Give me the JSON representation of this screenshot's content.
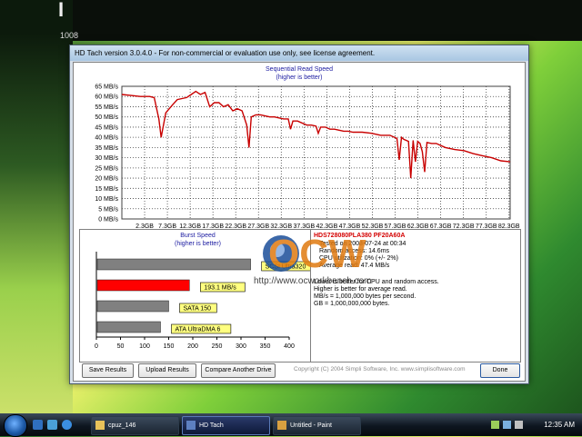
{
  "desktop": {
    "corner_big": "I",
    "corner_number": "1008"
  },
  "window": {
    "title": "HD Tach version 3.0.4.0  - For non-commercial or evaluation use only, see license agreement."
  },
  "sequential": {
    "title": "Sequential Read Speed",
    "subtitle": "(higher is better)"
  },
  "chart_data": [
    {
      "type": "line",
      "title": "Sequential Read Speed",
      "subtitle": "(higher is better)",
      "y_ticks": [
        "65 MB/s",
        "60 MB/s",
        "55 MB/s",
        "50 MB/s",
        "45 MB/s",
        "40 MB/s",
        "35 MB/s",
        "30 MB/s",
        "25 MB/s",
        "20 MB/s",
        "15 MB/s",
        "10 MB/s",
        "5 MB/s",
        "0 MB/s"
      ],
      "x_ticks": [
        "2.3GB",
        "7.3GB",
        "12.3GB",
        "17.3GB",
        "22.3GB",
        "27.3GB",
        "32.3GB",
        "37.3GB",
        "42.3GB",
        "47.3GB",
        "52.3GB",
        "57.3GB",
        "62.3GB",
        "67.3GB",
        "72.3GB",
        "77.3GB",
        "82.3GB"
      ],
      "ylim": [
        0,
        65
      ],
      "xlim": [
        0,
        84
      ],
      "grid": true,
      "series": [
        {
          "color": "#c80000",
          "x": [
            0,
            2,
            4,
            6,
            7,
            8,
            8.5,
            9.5,
            11,
            12,
            13,
            14,
            15,
            16,
            17,
            18,
            19,
            20,
            21,
            22,
            23,
            24,
            25,
            26,
            27,
            27.5,
            28,
            29,
            30,
            32,
            33,
            34,
            35,
            36,
            36.5,
            37,
            38,
            40,
            41,
            42,
            42.5,
            43,
            44,
            45,
            46,
            47,
            48,
            49,
            50,
            52,
            54,
            55,
            56,
            58,
            59.5,
            60,
            60.5,
            61,
            62,
            62.5,
            63,
            63.5,
            64,
            64.5,
            65,
            65.5,
            66,
            67,
            68,
            70,
            72,
            74,
            76,
            78,
            80,
            82,
            84
          ],
          "y": [
            61,
            60.5,
            60,
            60,
            59.5,
            49,
            40,
            52,
            56,
            58.5,
            59,
            59.5,
            61,
            62.5,
            61,
            62,
            55,
            57,
            57,
            55,
            56,
            53,
            54,
            53,
            46,
            35,
            50,
            51,
            51,
            50,
            50,
            49.5,
            49,
            49,
            44,
            48,
            48,
            46,
            46,
            45.5,
            42,
            45,
            45,
            44,
            44,
            43.5,
            43,
            43,
            42.5,
            42.5,
            42,
            41.5,
            41,
            41,
            39.5,
            29,
            40,
            39,
            38,
            20,
            38.5,
            28,
            38,
            37,
            33,
            23,
            37.5,
            37,
            37,
            35,
            34,
            33.5,
            32,
            31,
            30,
            28.5,
            28
          ]
        }
      ]
    },
    {
      "type": "bar",
      "title": "Burst Speed",
      "subtitle": "(higher is better)",
      "categories": [
        "SCSI Ultra320",
        "193.1 MB/s",
        "SATA 150",
        "ATA UltraDMA 6"
      ],
      "values": [
        320,
        193.1,
        150,
        133
      ],
      "colors": [
        "#808080",
        "#ff0000",
        "#808080",
        "#808080"
      ],
      "x_ticks": [
        "0",
        "50",
        "100",
        "150",
        "200",
        "250",
        "300",
        "350",
        "400"
      ],
      "xlim": [
        0,
        400
      ]
    }
  ],
  "burst": {
    "title": "Burst Speed",
    "subtitle": "(higher is better)"
  },
  "info": {
    "drive": "HDS728080PLA380 PF20A60A",
    "tested": "Tested on 2008-07-24 at 00:34",
    "random_access": "Random access: 14.6ms",
    "cpu": "CPU utilization: 0% (+/- 2%)",
    "average_read": "Average read: 47.4 MB/s",
    "note1": "Lower is better for CPU and random access.",
    "note2": "Higher is better for average read.",
    "note3": "MB/s = 1,000,000 bytes per second.",
    "note4": "GB = 1,000,000,000 bytes."
  },
  "buttons": {
    "save": "Save Results",
    "upload": "Upload Results",
    "compare": "Compare Another Drive",
    "done": "Done"
  },
  "copyright": "Copyright (C) 2004 Simpli Software, Inc. www.simplisoftware.com",
  "watermark": {
    "logo": "OCW",
    "url": "http://www.ocworkbench.com"
  },
  "taskbar": {
    "items": [
      {
        "label": "cpuz_146",
        "icon": "folder-icon"
      },
      {
        "label": "HD Tach",
        "icon": "hdtach-icon",
        "active": true
      },
      {
        "label": "Untitled - Paint",
        "icon": "paint-icon"
      }
    ],
    "clock": "12:35 AM"
  }
}
